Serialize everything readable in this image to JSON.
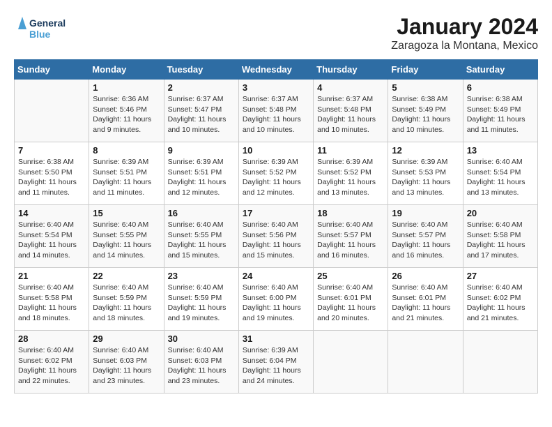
{
  "header": {
    "logo_line1": "General",
    "logo_line2": "Blue",
    "title": "January 2024",
    "subtitle": "Zaragoza la Montana, Mexico"
  },
  "weekdays": [
    "Sunday",
    "Monday",
    "Tuesday",
    "Wednesday",
    "Thursday",
    "Friday",
    "Saturday"
  ],
  "weeks": [
    [
      {
        "day": "",
        "sunrise": "",
        "sunset": "",
        "daylight": ""
      },
      {
        "day": "1",
        "sunrise": "Sunrise: 6:36 AM",
        "sunset": "Sunset: 5:46 PM",
        "daylight": "Daylight: 11 hours and 9 minutes."
      },
      {
        "day": "2",
        "sunrise": "Sunrise: 6:37 AM",
        "sunset": "Sunset: 5:47 PM",
        "daylight": "Daylight: 11 hours and 10 minutes."
      },
      {
        "day": "3",
        "sunrise": "Sunrise: 6:37 AM",
        "sunset": "Sunset: 5:48 PM",
        "daylight": "Daylight: 11 hours and 10 minutes."
      },
      {
        "day": "4",
        "sunrise": "Sunrise: 6:37 AM",
        "sunset": "Sunset: 5:48 PM",
        "daylight": "Daylight: 11 hours and 10 minutes."
      },
      {
        "day": "5",
        "sunrise": "Sunrise: 6:38 AM",
        "sunset": "Sunset: 5:49 PM",
        "daylight": "Daylight: 11 hours and 10 minutes."
      },
      {
        "day": "6",
        "sunrise": "Sunrise: 6:38 AM",
        "sunset": "Sunset: 5:49 PM",
        "daylight": "Daylight: 11 hours and 11 minutes."
      }
    ],
    [
      {
        "day": "7",
        "sunrise": "Sunrise: 6:38 AM",
        "sunset": "Sunset: 5:50 PM",
        "daylight": "Daylight: 11 hours and 11 minutes."
      },
      {
        "day": "8",
        "sunrise": "Sunrise: 6:39 AM",
        "sunset": "Sunset: 5:51 PM",
        "daylight": "Daylight: 11 hours and 11 minutes."
      },
      {
        "day": "9",
        "sunrise": "Sunrise: 6:39 AM",
        "sunset": "Sunset: 5:51 PM",
        "daylight": "Daylight: 11 hours and 12 minutes."
      },
      {
        "day": "10",
        "sunrise": "Sunrise: 6:39 AM",
        "sunset": "Sunset: 5:52 PM",
        "daylight": "Daylight: 11 hours and 12 minutes."
      },
      {
        "day": "11",
        "sunrise": "Sunrise: 6:39 AM",
        "sunset": "Sunset: 5:52 PM",
        "daylight": "Daylight: 11 hours and 13 minutes."
      },
      {
        "day": "12",
        "sunrise": "Sunrise: 6:39 AM",
        "sunset": "Sunset: 5:53 PM",
        "daylight": "Daylight: 11 hours and 13 minutes."
      },
      {
        "day": "13",
        "sunrise": "Sunrise: 6:40 AM",
        "sunset": "Sunset: 5:54 PM",
        "daylight": "Daylight: 11 hours and 13 minutes."
      }
    ],
    [
      {
        "day": "14",
        "sunrise": "Sunrise: 6:40 AM",
        "sunset": "Sunset: 5:54 PM",
        "daylight": "Daylight: 11 hours and 14 minutes."
      },
      {
        "day": "15",
        "sunrise": "Sunrise: 6:40 AM",
        "sunset": "Sunset: 5:55 PM",
        "daylight": "Daylight: 11 hours and 14 minutes."
      },
      {
        "day": "16",
        "sunrise": "Sunrise: 6:40 AM",
        "sunset": "Sunset: 5:55 PM",
        "daylight": "Daylight: 11 hours and 15 minutes."
      },
      {
        "day": "17",
        "sunrise": "Sunrise: 6:40 AM",
        "sunset": "Sunset: 5:56 PM",
        "daylight": "Daylight: 11 hours and 15 minutes."
      },
      {
        "day": "18",
        "sunrise": "Sunrise: 6:40 AM",
        "sunset": "Sunset: 5:57 PM",
        "daylight": "Daylight: 11 hours and 16 minutes."
      },
      {
        "day": "19",
        "sunrise": "Sunrise: 6:40 AM",
        "sunset": "Sunset: 5:57 PM",
        "daylight": "Daylight: 11 hours and 16 minutes."
      },
      {
        "day": "20",
        "sunrise": "Sunrise: 6:40 AM",
        "sunset": "Sunset: 5:58 PM",
        "daylight": "Daylight: 11 hours and 17 minutes."
      }
    ],
    [
      {
        "day": "21",
        "sunrise": "Sunrise: 6:40 AM",
        "sunset": "Sunset: 5:58 PM",
        "daylight": "Daylight: 11 hours and 18 minutes."
      },
      {
        "day": "22",
        "sunrise": "Sunrise: 6:40 AM",
        "sunset": "Sunset: 5:59 PM",
        "daylight": "Daylight: 11 hours and 18 minutes."
      },
      {
        "day": "23",
        "sunrise": "Sunrise: 6:40 AM",
        "sunset": "Sunset: 5:59 PM",
        "daylight": "Daylight: 11 hours and 19 minutes."
      },
      {
        "day": "24",
        "sunrise": "Sunrise: 6:40 AM",
        "sunset": "Sunset: 6:00 PM",
        "daylight": "Daylight: 11 hours and 19 minutes."
      },
      {
        "day": "25",
        "sunrise": "Sunrise: 6:40 AM",
        "sunset": "Sunset: 6:01 PM",
        "daylight": "Daylight: 11 hours and 20 minutes."
      },
      {
        "day": "26",
        "sunrise": "Sunrise: 6:40 AM",
        "sunset": "Sunset: 6:01 PM",
        "daylight": "Daylight: 11 hours and 21 minutes."
      },
      {
        "day": "27",
        "sunrise": "Sunrise: 6:40 AM",
        "sunset": "Sunset: 6:02 PM",
        "daylight": "Daylight: 11 hours and 21 minutes."
      }
    ],
    [
      {
        "day": "28",
        "sunrise": "Sunrise: 6:40 AM",
        "sunset": "Sunset: 6:02 PM",
        "daylight": "Daylight: 11 hours and 22 minutes."
      },
      {
        "day": "29",
        "sunrise": "Sunrise: 6:40 AM",
        "sunset": "Sunset: 6:03 PM",
        "daylight": "Daylight: 11 hours and 23 minutes."
      },
      {
        "day": "30",
        "sunrise": "Sunrise: 6:40 AM",
        "sunset": "Sunset: 6:03 PM",
        "daylight": "Daylight: 11 hours and 23 minutes."
      },
      {
        "day": "31",
        "sunrise": "Sunrise: 6:39 AM",
        "sunset": "Sunset: 6:04 PM",
        "daylight": "Daylight: 11 hours and 24 minutes."
      },
      {
        "day": "",
        "sunrise": "",
        "sunset": "",
        "daylight": ""
      },
      {
        "day": "",
        "sunrise": "",
        "sunset": "",
        "daylight": ""
      },
      {
        "day": "",
        "sunrise": "",
        "sunset": "",
        "daylight": ""
      }
    ]
  ]
}
